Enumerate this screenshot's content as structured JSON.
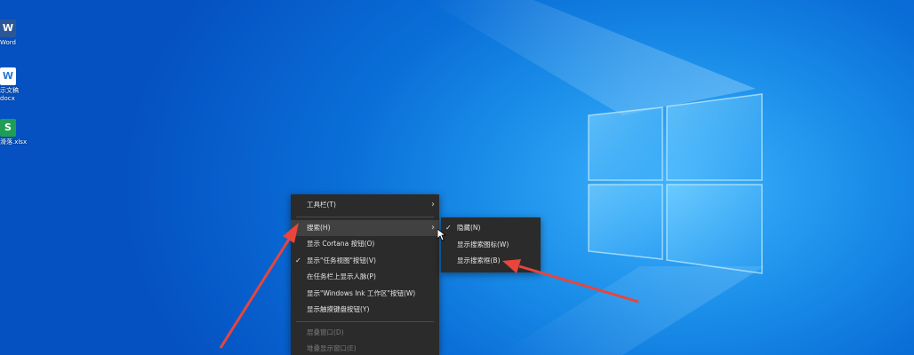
{
  "desktop": {
    "icons": [
      {
        "glyph": "W",
        "label_line1": "Word",
        "label_line2": "",
        "color": "#2b5797"
      },
      {
        "glyph": "W",
        "label_line1": "示文稿",
        "label_line2": "docx",
        "color": "#2b78d6"
      },
      {
        "glyph": "S",
        "label_line1": "滑落.xlsx",
        "label_line2": "",
        "color": "#1f9d55"
      }
    ]
  },
  "context_menu": {
    "items": [
      {
        "label": "工具栏(T)",
        "checked": false,
        "has_submenu": true,
        "disabled": false
      },
      {
        "label": "搜索(H)",
        "checked": false,
        "has_submenu": true,
        "disabled": false,
        "highlighted": true
      },
      {
        "label": "显示 Cortana 按钮(O)",
        "checked": false,
        "has_submenu": false,
        "disabled": false
      },
      {
        "label": "显示\"任务视图\"按钮(V)",
        "checked": true,
        "has_submenu": false,
        "disabled": false
      },
      {
        "label": "在任务栏上显示人脉(P)",
        "checked": false,
        "has_submenu": false,
        "disabled": false
      },
      {
        "label": "显示\"Windows Ink 工作区\"按钮(W)",
        "checked": false,
        "has_submenu": false,
        "disabled": false
      },
      {
        "label": "显示触摸键盘按钮(Y)",
        "checked": false,
        "has_submenu": false,
        "disabled": false
      },
      {
        "label": "层叠窗口(D)",
        "checked": false,
        "has_submenu": false,
        "disabled": true
      },
      {
        "label": "堆叠显示窗口(E)",
        "checked": false,
        "has_submenu": false,
        "disabled": true
      }
    ],
    "check_glyph": "✓",
    "arrow_glyph": "›"
  },
  "search_submenu": {
    "items": [
      {
        "label": "隐藏(N)",
        "checked": true
      },
      {
        "label": "显示搜索图标(W)",
        "checked": false
      },
      {
        "label": "显示搜索框(B)",
        "checked": false
      }
    ]
  },
  "colors": {
    "menu_bg": "#2b2b2b",
    "menu_highlight": "#414141",
    "annotation_arrow": "#e8453c"
  }
}
